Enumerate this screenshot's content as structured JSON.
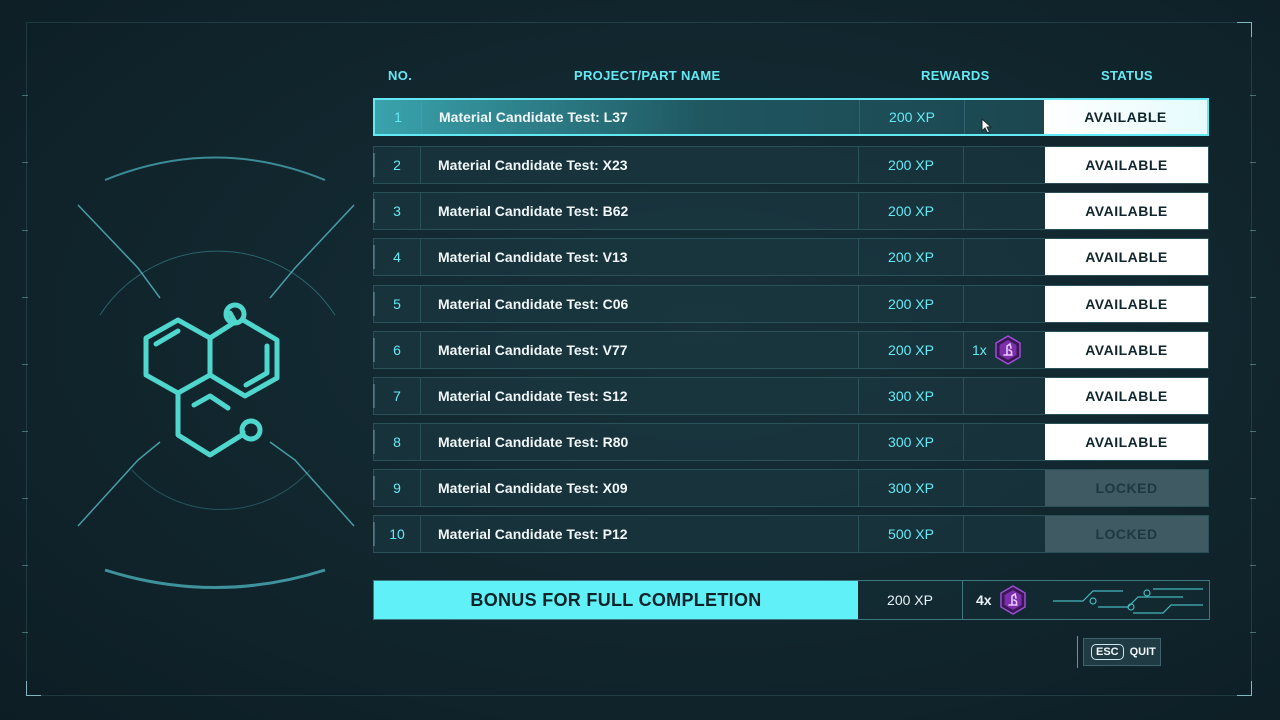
{
  "headers": {
    "no": "NO.",
    "name": "PROJECT/PART NAME",
    "rewards": "REWARDS",
    "status": "STATUS"
  },
  "rows": [
    {
      "no": "1",
      "name": "Material Candidate Test: L37",
      "xp": "200 XP",
      "item_count": "",
      "status": "AVAILABLE",
      "locked": false,
      "selected": true
    },
    {
      "no": "2",
      "name": "Material Candidate Test: X23",
      "xp": "200 XP",
      "item_count": "",
      "status": "AVAILABLE",
      "locked": false
    },
    {
      "no": "3",
      "name": "Material Candidate Test: B62",
      "xp": "200 XP",
      "item_count": "",
      "status": "AVAILABLE",
      "locked": false
    },
    {
      "no": "4",
      "name": "Material Candidate Test: V13",
      "xp": "200 XP",
      "item_count": "",
      "status": "AVAILABLE",
      "locked": false
    },
    {
      "no": "5",
      "name": "Material Candidate Test: C06",
      "xp": "200 XP",
      "item_count": "",
      "status": "AVAILABLE",
      "locked": false
    },
    {
      "no": "6",
      "name": "Material Candidate Test: V77",
      "xp": "200 XP",
      "item_count": "1x",
      "status": "AVAILABLE",
      "locked": false
    },
    {
      "no": "7",
      "name": "Material Candidate Test: S12",
      "xp": "300 XP",
      "item_count": "",
      "status": "AVAILABLE",
      "locked": false
    },
    {
      "no": "8",
      "name": "Material Candidate Test: R80",
      "xp": "300 XP",
      "item_count": "",
      "status": "AVAILABLE",
      "locked": false
    },
    {
      "no": "9",
      "name": "Material Candidate Test: X09",
      "xp": "300 XP",
      "item_count": "",
      "status": "LOCKED",
      "locked": true
    },
    {
      "no": "10",
      "name": "Material Candidate Test: P12",
      "xp": "500 XP",
      "item_count": "",
      "status": "LOCKED",
      "locked": true
    }
  ],
  "bonus": {
    "label": "BONUS FOR FULL COMPLETION",
    "xp": "200 XP",
    "item_count": "4x"
  },
  "footer": {
    "esc_key": "ESC",
    "quit_label": "QUIT"
  },
  "icons": {
    "emblem": "molecule-icon",
    "reward_item": "microscope-token-icon",
    "cursor": "mouse-cursor-icon"
  },
  "colors": {
    "accent": "#63e9f3",
    "available_bg": "#ffffff",
    "locked_bg": "#3f5a63",
    "token": "#7b2fa8"
  }
}
